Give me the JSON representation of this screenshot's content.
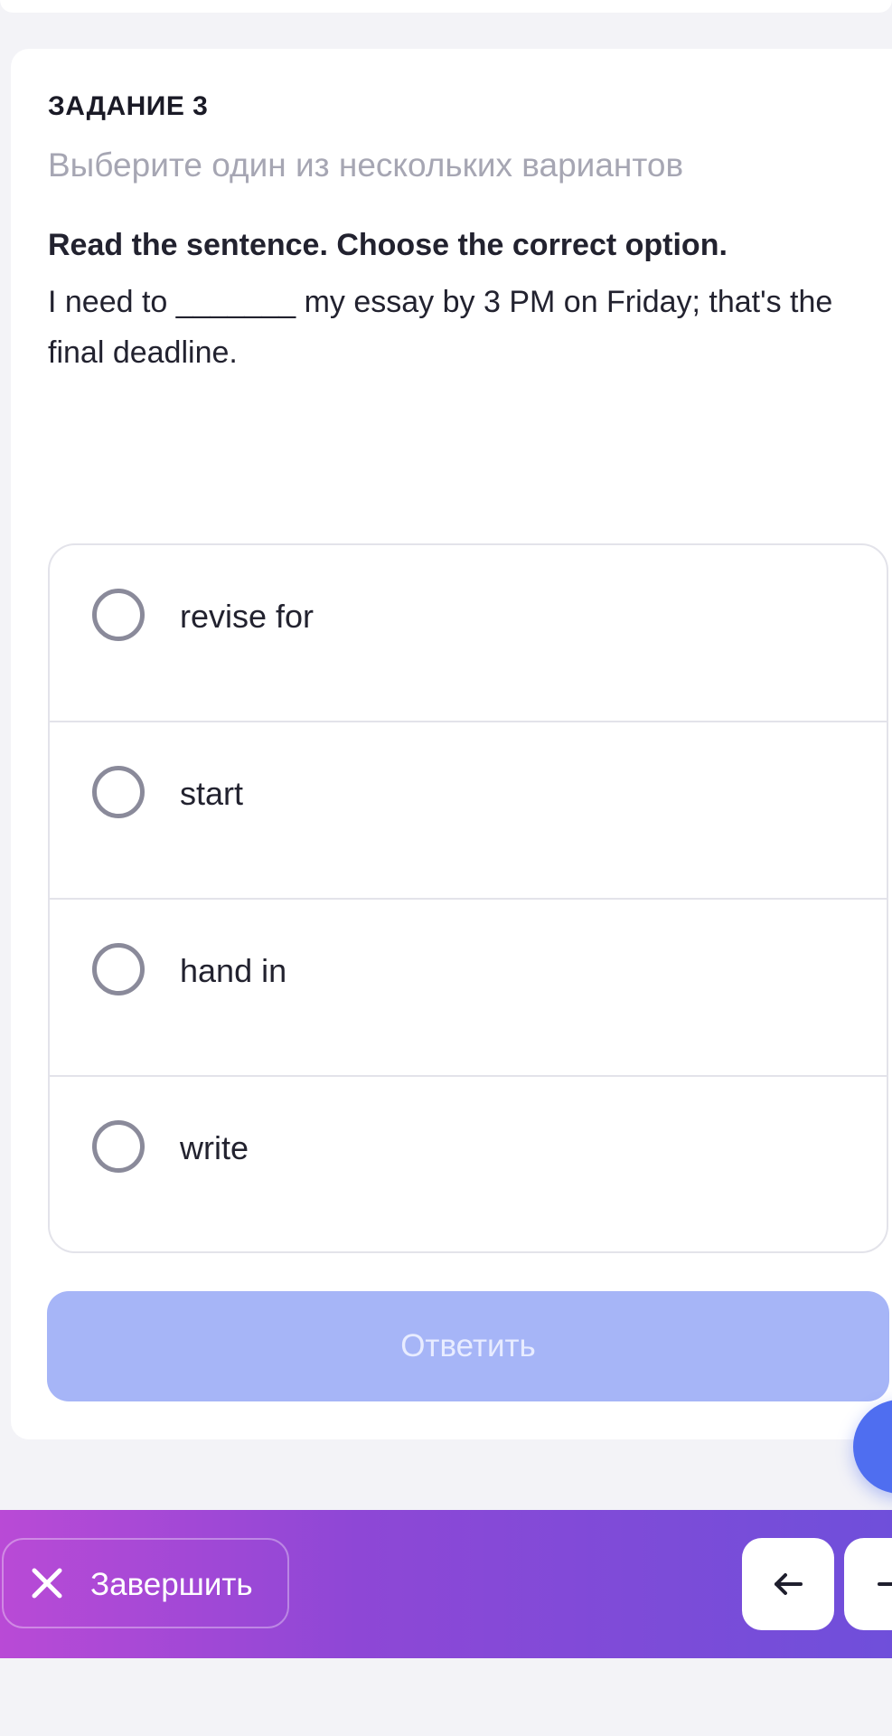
{
  "task": {
    "title": "ЗАДАНИЕ 3",
    "subtitle": "Выберите один из нескольких вариантов",
    "instruction": "Read the sentence. Choose the correct option.",
    "question": "I need to _______ my essay by 3 PM on Friday; that's the final deadline."
  },
  "options": [
    {
      "label": "revise for"
    },
    {
      "label": "start"
    },
    {
      "label": "hand in"
    },
    {
      "label": "write"
    }
  ],
  "answer_button": {
    "label": "Ответить"
  },
  "bottom_bar": {
    "finish_label": "Завершить",
    "prev_icon": "arrow-left-icon",
    "next_icon": "arrow-right-icon"
  },
  "colors": {
    "accent": "#4f6ef0",
    "answer_disabled": "#a6b5f7",
    "bar_gradient_start": "#b94ad6",
    "bar_gradient_end": "#6f4fda"
  }
}
